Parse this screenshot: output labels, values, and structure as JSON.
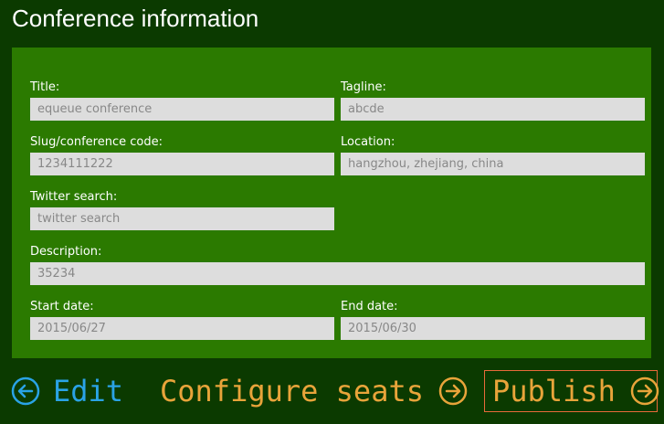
{
  "page": {
    "title": "Conference information"
  },
  "form": {
    "title": {
      "label": "Title:",
      "value": "equeue conference"
    },
    "tagline": {
      "label": "Tagline:",
      "value": "abcde"
    },
    "slug": {
      "label": "Slug/conference code:",
      "value": "1234111222"
    },
    "location": {
      "label": "Location:",
      "value": "hangzhou, zhejiang, china"
    },
    "twitter": {
      "label": "Twitter search:",
      "placeholder": "twitter search"
    },
    "description": {
      "label": "Description:",
      "value": "35234"
    },
    "start_date": {
      "label": "Start date:",
      "value": "2015/06/27"
    },
    "end_date": {
      "label": "End date:",
      "value": "2015/06/30"
    }
  },
  "actions": {
    "edit": {
      "label": "Edit",
      "icon": "arrow-left-circle-icon",
      "color": "#2aa3e6"
    },
    "configure_seats": {
      "label": "Configure seats",
      "icon": "arrow-right-circle-icon",
      "color": "#e8a43a"
    },
    "publish": {
      "label": "Publish",
      "icon": "arrow-right-circle-icon",
      "color": "#e8a43a",
      "border_color": "#e86a3a"
    }
  },
  "theme": {
    "background": "#0b3a00",
    "panel": "#2b7a00",
    "input_background": "#dddddd",
    "input_text": "#888888"
  }
}
